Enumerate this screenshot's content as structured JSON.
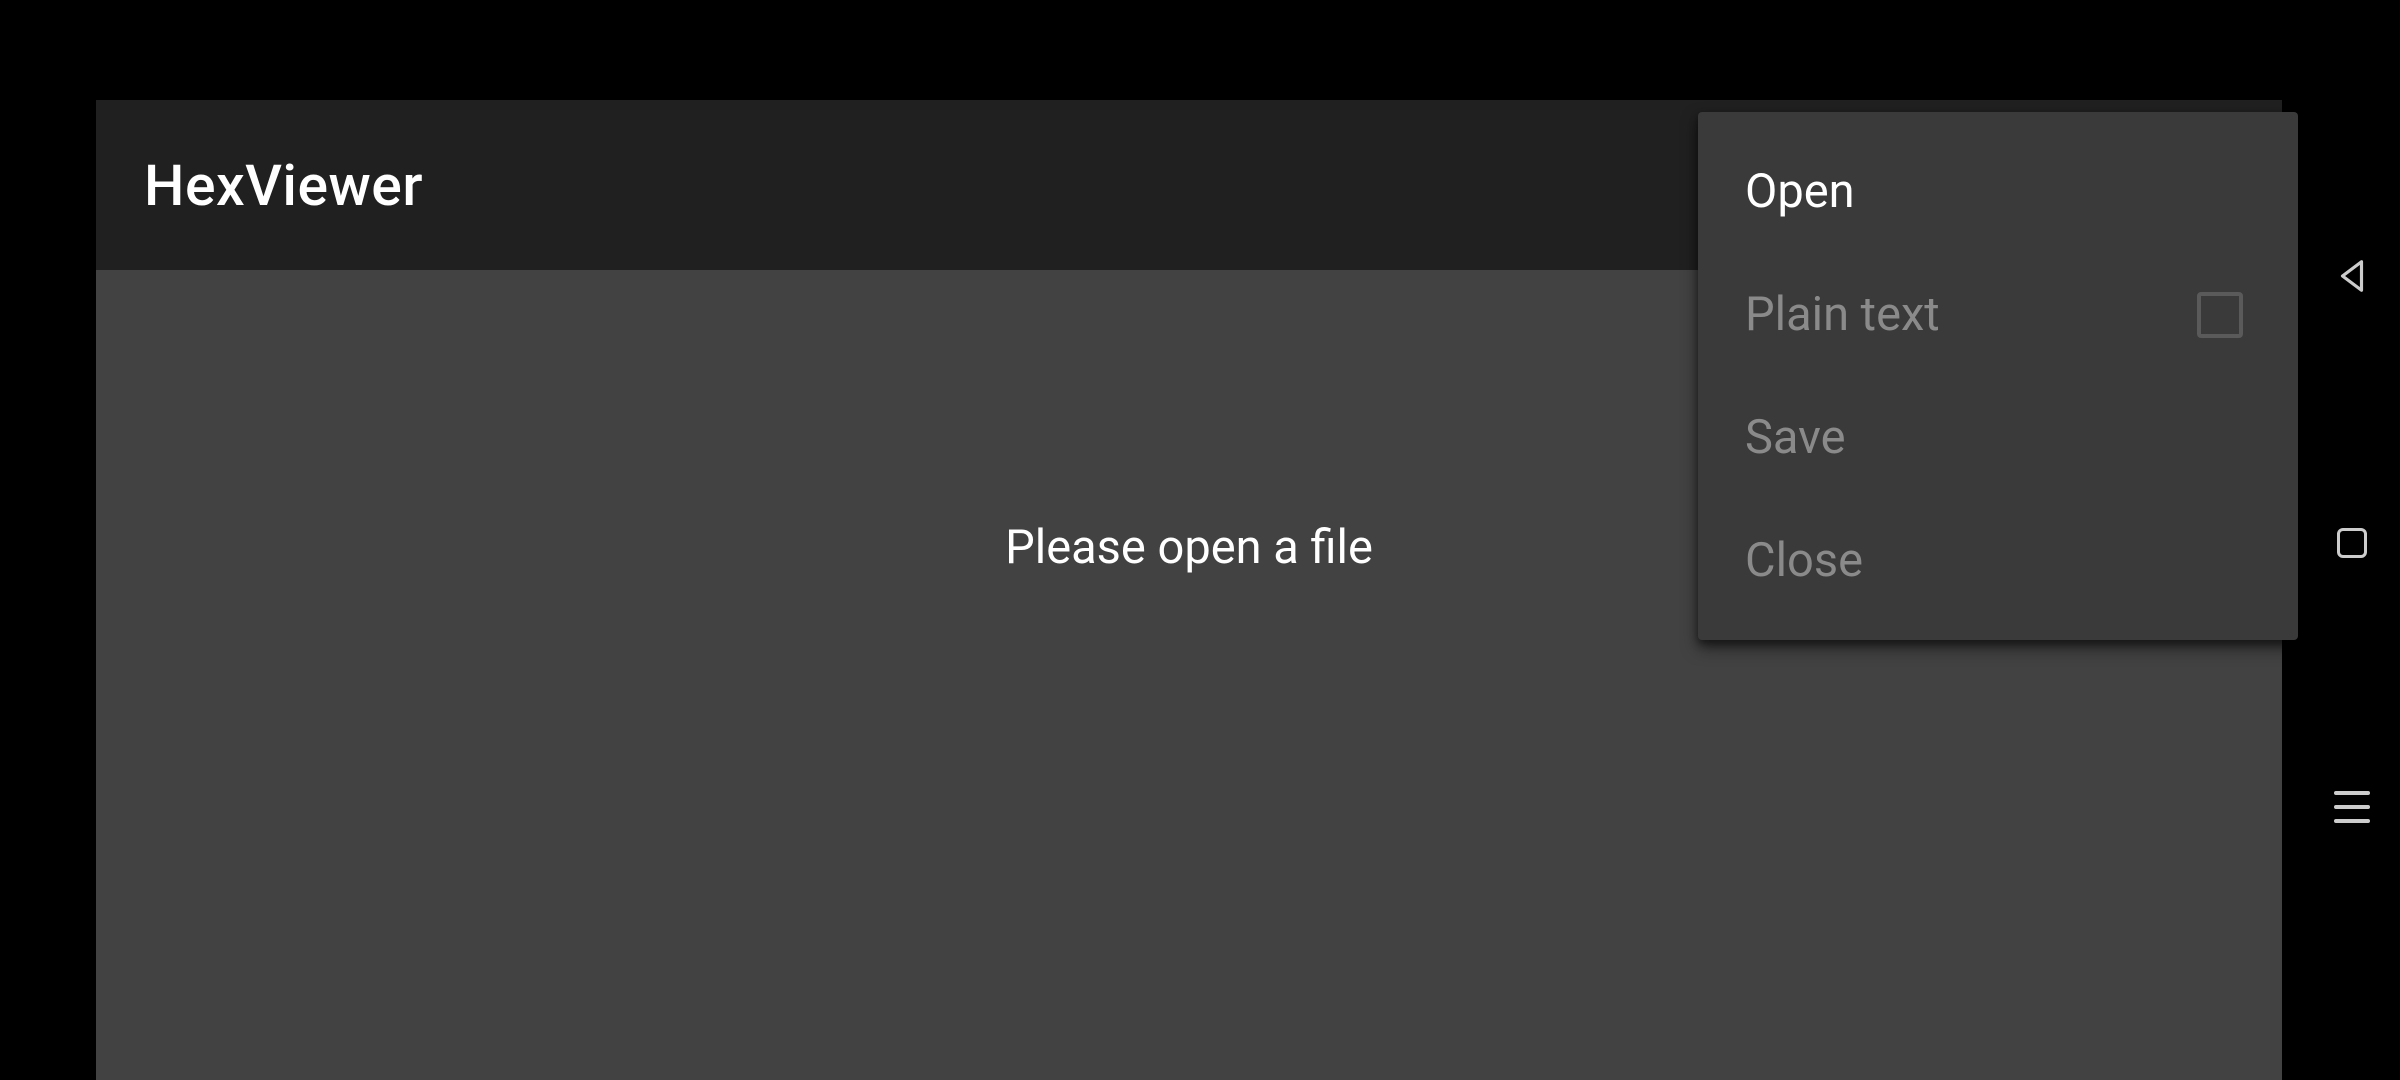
{
  "header": {
    "title": "HexViewer"
  },
  "content": {
    "placeholder": "Please open a file"
  },
  "menu": {
    "open": "Open",
    "plainText": "Plain text",
    "save": "Save",
    "close": "Close"
  }
}
